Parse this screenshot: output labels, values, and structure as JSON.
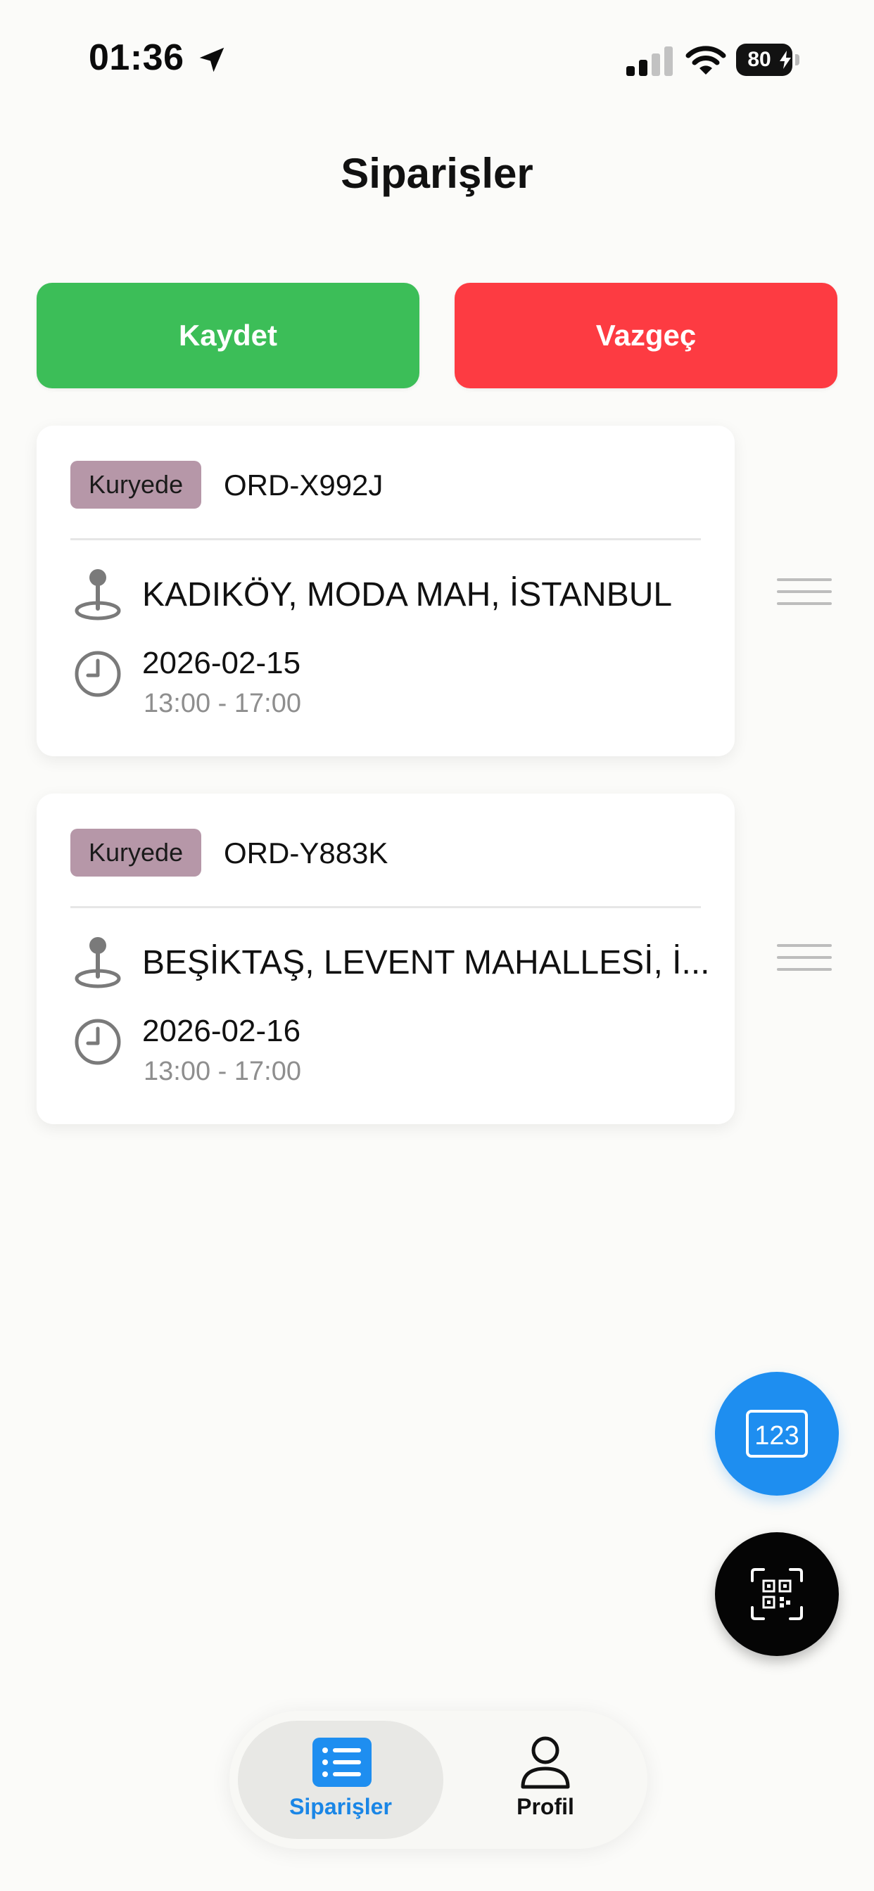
{
  "status_bar": {
    "time": "01:36",
    "battery": "80"
  },
  "header": {
    "title": "Siparişler"
  },
  "actions": {
    "save_label": "Kaydet",
    "cancel_label": "Vazgeç"
  },
  "orders": [
    {
      "status": "Kuryede",
      "id": "ORD-X992J",
      "address": "KADIKÖY, MODA MAH, İSTANBUL",
      "date": "2026-02-15",
      "time_window": "13:00 - 17:00"
    },
    {
      "status": "Kuryede",
      "id": "ORD-Y883K",
      "address": "BEŞİKTAŞ, LEVENT MAHALLESİ, İ...",
      "date": "2026-02-16",
      "time_window": "13:00 - 17:00"
    }
  ],
  "fabs": {
    "number_label": "123"
  },
  "tabbar": {
    "items": [
      {
        "label": "Siparişler",
        "active": true
      },
      {
        "label": "Profil",
        "active": false
      }
    ]
  },
  "colors": {
    "save": "#3cbe58",
    "cancel": "#fd3b42",
    "badge": "#b697a8",
    "accent": "#1e8ef0"
  },
  "icons": {
    "status": [
      "location-arrow-icon",
      "cellular-signal-icon",
      "wifi-icon",
      "battery-icon"
    ],
    "card": [
      "map-pin-icon",
      "clock-icon",
      "drag-handle-icon"
    ],
    "fab": [
      "number-pad-icon",
      "qr-scan-icon"
    ],
    "tabbar": [
      "list-icon",
      "person-icon"
    ]
  }
}
